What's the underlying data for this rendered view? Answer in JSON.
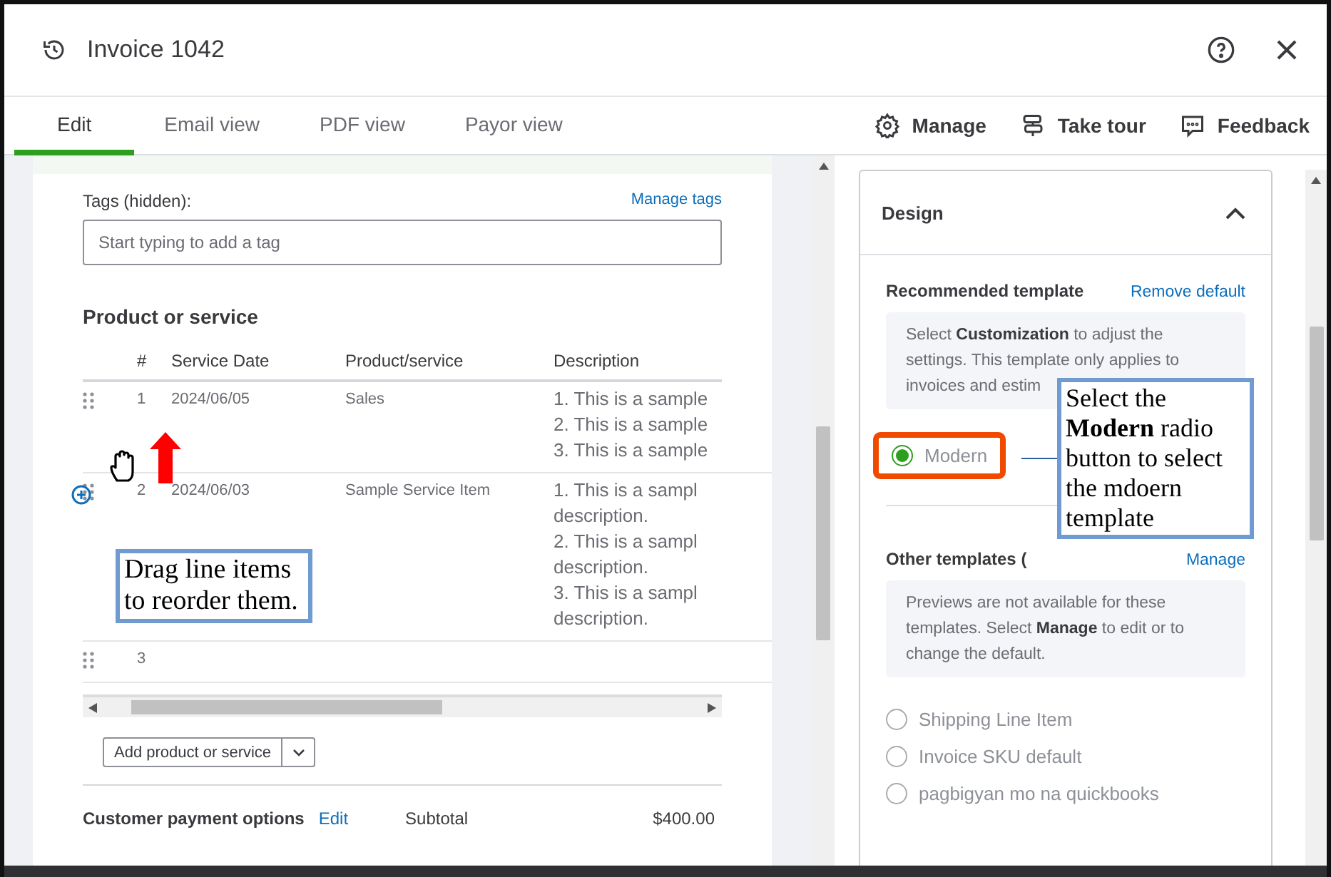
{
  "window": {
    "title": "Invoice 1042"
  },
  "tabs": [
    {
      "label": "Edit",
      "selected": true
    },
    {
      "label": "Email view",
      "selected": false
    },
    {
      "label": "PDF view",
      "selected": false
    },
    {
      "label": "Payor view",
      "selected": false
    }
  ],
  "actions": [
    {
      "kind": "gear",
      "label": "Manage"
    },
    {
      "kind": "signpost",
      "label": "Take tour"
    },
    {
      "kind": "chat",
      "label": "Feedback"
    }
  ],
  "tags": {
    "label": "Tags (hidden):",
    "link": "Manage tags",
    "placeholder": "Start typing to add a tag"
  },
  "products": {
    "title": "Product or service",
    "columns": [
      "#",
      "Service Date",
      "Product/service",
      "Description"
    ],
    "rows": [
      {
        "number": "1",
        "date": "2024/06/05",
        "item": "Sales",
        "hovered": false,
        "description": [
          "1. This is a sample",
          "2. This is a sample",
          "3. This is a sample"
        ]
      },
      {
        "number": "2",
        "date": "2024/06/03",
        "item": "Sample Service Item",
        "hovered": true,
        "description": [
          "1. This is a sampl",
          "description.",
          "2. This is a sampl",
          "description.",
          "3. This is a sampl",
          "description."
        ]
      },
      {
        "number": "3",
        "hovered": false
      }
    ],
    "add_button": "Add product or service"
  },
  "footer": {
    "label": "Customer payment options",
    "link": "Edit",
    "subtotal_label": "Subtotal",
    "subtotal": "$400.00"
  },
  "design": {
    "title": "Design",
    "expanded": true,
    "recommended": {
      "title": "Recommended template",
      "link": "Remove default",
      "info": "Select **Customization** to adjust the settings. This template only applies to invoices and estim",
      "templates": [
        {
          "label": "Modern",
          "selected": true
        }
      ]
    },
    "other": {
      "title": "Other templates (",
      "link": "Manage",
      "info": "Previews are not available for these templates. Select **Manage** to edit or to change the default.",
      "templates": [
        {
          "label": "Shipping Line Item",
          "selected": false
        },
        {
          "label": "Invoice SKU default",
          "selected": false
        },
        {
          "label": "pagbigyan mo na quickbooks",
          "selected": false
        }
      ]
    }
  },
  "annotations": [
    {
      "text": "Drag line items to reorder them."
    },
    {
      "text": "Select the **Modern** radio button to select the mdoern template"
    }
  ]
}
